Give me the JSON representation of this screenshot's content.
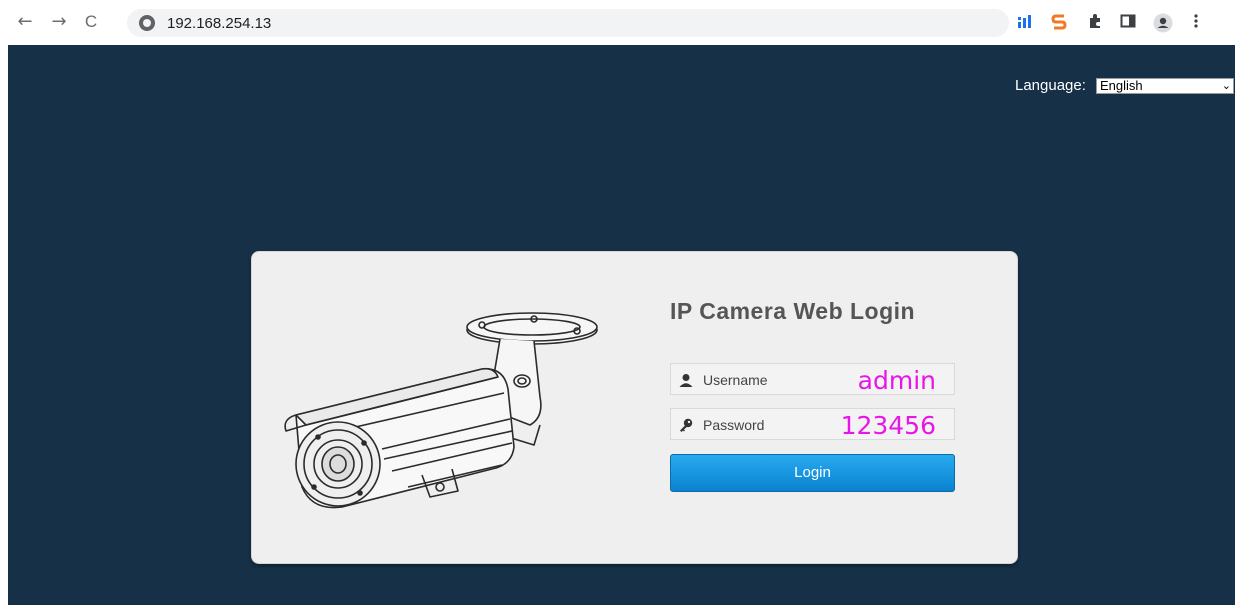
{
  "browser": {
    "back_icon": "←",
    "forward_icon": "→",
    "reload_icon": "C",
    "address": "192.168.254.13",
    "extensions": [
      "bar-chart-icon",
      "s-extension-icon",
      "puzzle-icon",
      "sidepanel-icon",
      "profile-icon",
      "menu-icon"
    ]
  },
  "language": {
    "label": "Language:",
    "selected": "English"
  },
  "login": {
    "title": "IP Camera Web Login",
    "username_placeholder": "Username",
    "username_value": "admin",
    "password_placeholder": "Password",
    "password_value": "123456",
    "button_label": "Login"
  },
  "colors": {
    "page_bg": "#163048",
    "panel_bg": "#efefef",
    "button": "#1a96e0",
    "annotation": "#e815e8"
  }
}
